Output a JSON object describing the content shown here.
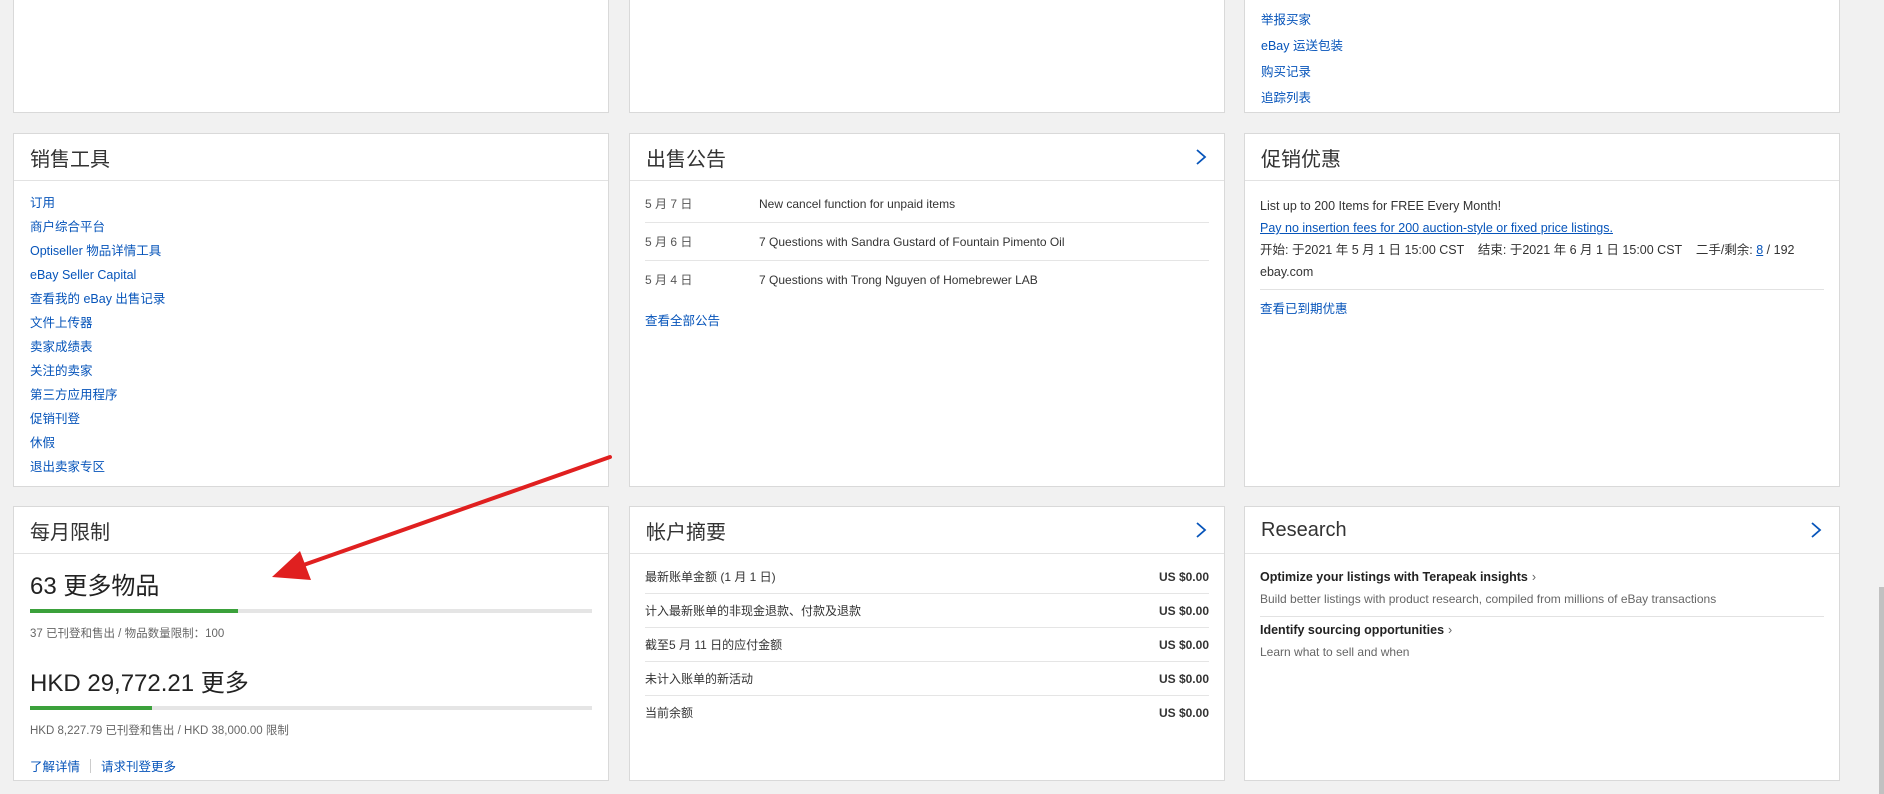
{
  "top_right_links": [
    "举报买家",
    "eBay 运送包装",
    "购买记录",
    "追踪列表"
  ],
  "selling_tools": {
    "title": "销售工具",
    "items": [
      "订用",
      "商户综合平台",
      "Optiseller 物品详情工具",
      "eBay Seller Capital",
      "查看我的 eBay 出售记录",
      "文件上传器",
      "卖家成绩表",
      "关注的卖家",
      "第三方应用程序",
      "促销刊登",
      "休假",
      "退出卖家专区"
    ]
  },
  "announcements": {
    "title": "出售公告",
    "rows": [
      {
        "date": "5 月 7 日",
        "text": "New cancel function for unpaid items"
      },
      {
        "date": "5 月 6 日",
        "text": "7 Questions with Sandra Gustard of Fountain Pimento Oil"
      },
      {
        "date": "5 月 4 日",
        "text": "7 Questions with Trong Nguyen of Homebrewer LAB"
      }
    ],
    "view_all": "查看全部公告"
  },
  "promotions": {
    "title": "促销优惠",
    "headline": "List up to 200 Items for FREE Every Month!",
    "link": "Pay no insertion fees for 200 auction-style or fixed price listings.",
    "period_prefix": "开始: 于2021 年 5 月 1 日 15:00 CST    结束: 于2021 年 6 月 1 日 15:00 CST    二手/剩余: ",
    "used": "8",
    "total": " / 192",
    "site": "ebay.com",
    "expired_link": "查看已到期优惠"
  },
  "monthly_limits": {
    "title": "每月限制",
    "items_big": "63 更多物品",
    "items_progress": 0.37,
    "items_note": "37 已刊登和售出 /  物品数量限制：100",
    "amount_big": "HKD 29,772.21 更多",
    "amount_progress": 0.2165,
    "amount_note": "HKD 8,227.79 已刊登和售出 /  HKD 38,000.00 限制",
    "learn_more": "了解详情",
    "request_more": "请求刊登更多"
  },
  "account_summary": {
    "title": "帐户摘要",
    "rows": [
      {
        "label": "最新账单金额 (1 月 1 日)",
        "amount": "US $0.00"
      },
      {
        "label": "计入最新账单的非现金退款、付款及退款",
        "amount": "US $0.00"
      },
      {
        "label": "截至5 月 11 日的应付金额",
        "amount": "US $0.00"
      },
      {
        "label": "未计入账单的新活动",
        "amount": "US $0.00"
      },
      {
        "label": "当前余额",
        "amount": "US $0.00"
      }
    ]
  },
  "research": {
    "title": "Research",
    "items": [
      {
        "heading": "Optimize your listings with Terapeak insights",
        "desc": "Build better listings with product research, compiled from millions of eBay transactions"
      },
      {
        "heading": "Identify sourcing opportunities",
        "desc": "Learn what to sell and when"
      }
    ]
  },
  "colors": {
    "link": "#0654ba",
    "progress": "#3ba13b",
    "annotation_arrow": "#e02020"
  }
}
